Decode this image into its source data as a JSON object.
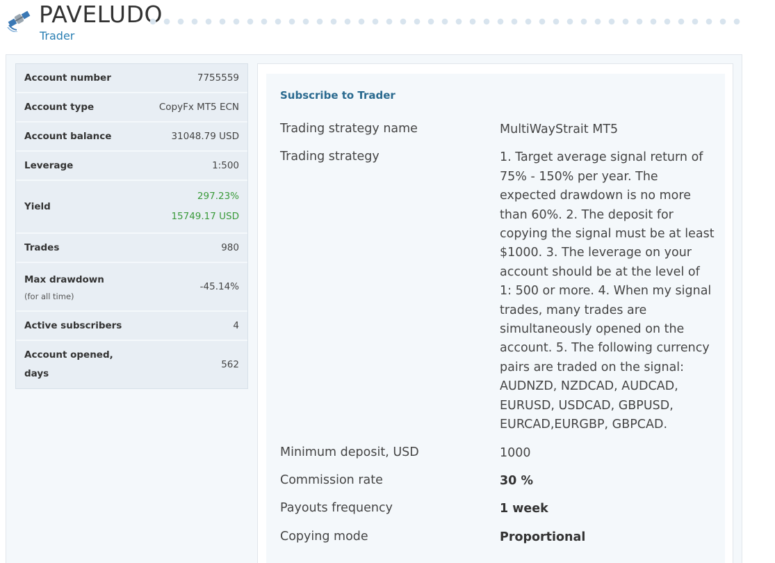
{
  "header": {
    "title": "PAVELUDO",
    "subtitle": "Trader",
    "icon": "satellite-icon"
  },
  "stats": {
    "account_number": {
      "label": "Account number",
      "value": "7755559"
    },
    "account_type": {
      "label": "Account type",
      "value": "CopyFx MT5 ECN"
    },
    "account_balance": {
      "label": "Account balance",
      "value": "31048.79 USD"
    },
    "leverage": {
      "label": "Leverage",
      "value": "1:500"
    },
    "yield": {
      "label": "Yield",
      "percent": "297.23%",
      "amount": "15749.17 USD"
    },
    "trades": {
      "label": "Trades",
      "value": "980"
    },
    "max_drawdown": {
      "label": "Max drawdown",
      "sublabel": "(for all time)",
      "value": "-45.14%"
    },
    "active_subscribers": {
      "label": "Active subscribers",
      "value": "4"
    },
    "account_opened": {
      "label": "Account opened, days",
      "value": "562"
    }
  },
  "subscribe": {
    "title": "Subscribe to Trader",
    "strategy_name": {
      "label": "Trading strategy name",
      "value": "MultiWayStrait MT5"
    },
    "strategy": {
      "label": "Trading strategy",
      "value": "1. Target average signal return of 75% - 150% per year. The expected drawdown is no more than 60%. 2. The deposit for copying the signal must be at least $1000. 3. The leverage on your account should be at the level of 1: 500 or more. 4. When my signal trades, many trades are simultaneously opened on the account. 5. The following currency pairs are traded on the signal: AUDNZD, NZDCAD, AUDCAD, EURUSD, USDCAD, GBPUSD, EURCAD,EURGBP, GBPCAD."
    },
    "min_deposit": {
      "label": "Minimum deposit, USD",
      "value": "1000"
    },
    "commission": {
      "label": "Commission rate",
      "value": "30 %"
    },
    "payouts": {
      "label": "Payouts frequency",
      "value": "1 week"
    },
    "copying_mode": {
      "label": "Copying mode",
      "value": "Proportional"
    }
  },
  "colors": {
    "accent": "#2a7fb3",
    "positive": "#3a9a3a",
    "panel_bg": "#f4f8fb"
  }
}
